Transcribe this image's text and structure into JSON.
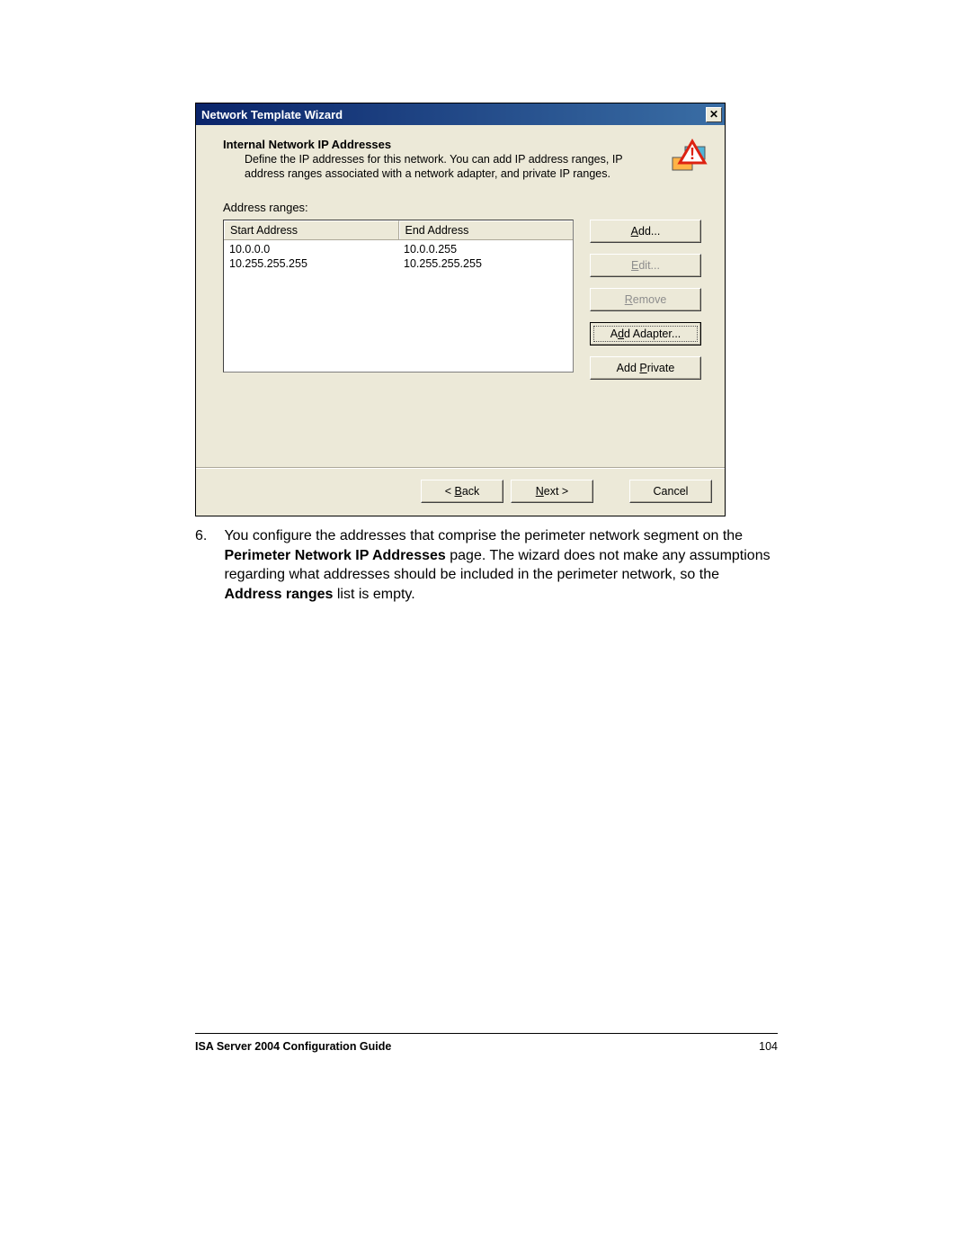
{
  "dialog": {
    "title": "Network Template Wizard",
    "close_glyph": "✕",
    "header_title": "Internal Network IP Addresses",
    "header_desc": "Define the IP addresses for this network. You can add IP address ranges, IP address ranges associated with a network adapter, and private IP ranges.",
    "ranges_label": "Address ranges:",
    "columns": {
      "start": "Start Address",
      "end": "End Address"
    },
    "rows": [
      {
        "start": "10.0.0.0",
        "end": "10.0.0.255"
      },
      {
        "start": "10.255.255.255",
        "end": "10.255.255.255"
      }
    ],
    "buttons": {
      "add_pre": "",
      "add_u": "A",
      "add_post": "dd...",
      "edit_pre": "",
      "edit_u": "E",
      "edit_post": "dit...",
      "remove_pre": "",
      "remove_u": "R",
      "remove_post": "emove",
      "addadapter_pre": "A",
      "addadapter_u": "d",
      "addadapter_post": "d Adapter...",
      "addprivate_pre": "Add ",
      "addprivate_u": "P",
      "addprivate_post": "rivate"
    },
    "nav": {
      "back_pre": "< ",
      "back_u": "B",
      "back_post": "ack",
      "next_pre": "",
      "next_u": "N",
      "next_post": "ext >",
      "cancel": "Cancel"
    }
  },
  "doc": {
    "item_number": "6.",
    "text_1": "You configure the addresses that comprise the perimeter network segment on the ",
    "bold_1": "Perimeter Network IP Addresses",
    "text_2": " page. The wizard does not make any assumptions regarding what addresses should be included in the perimeter network, so the ",
    "bold_2": "Address ranges",
    "text_3": " list is empty."
  },
  "footer": {
    "title": "ISA Server 2004 Configuration Guide",
    "page": "104"
  }
}
